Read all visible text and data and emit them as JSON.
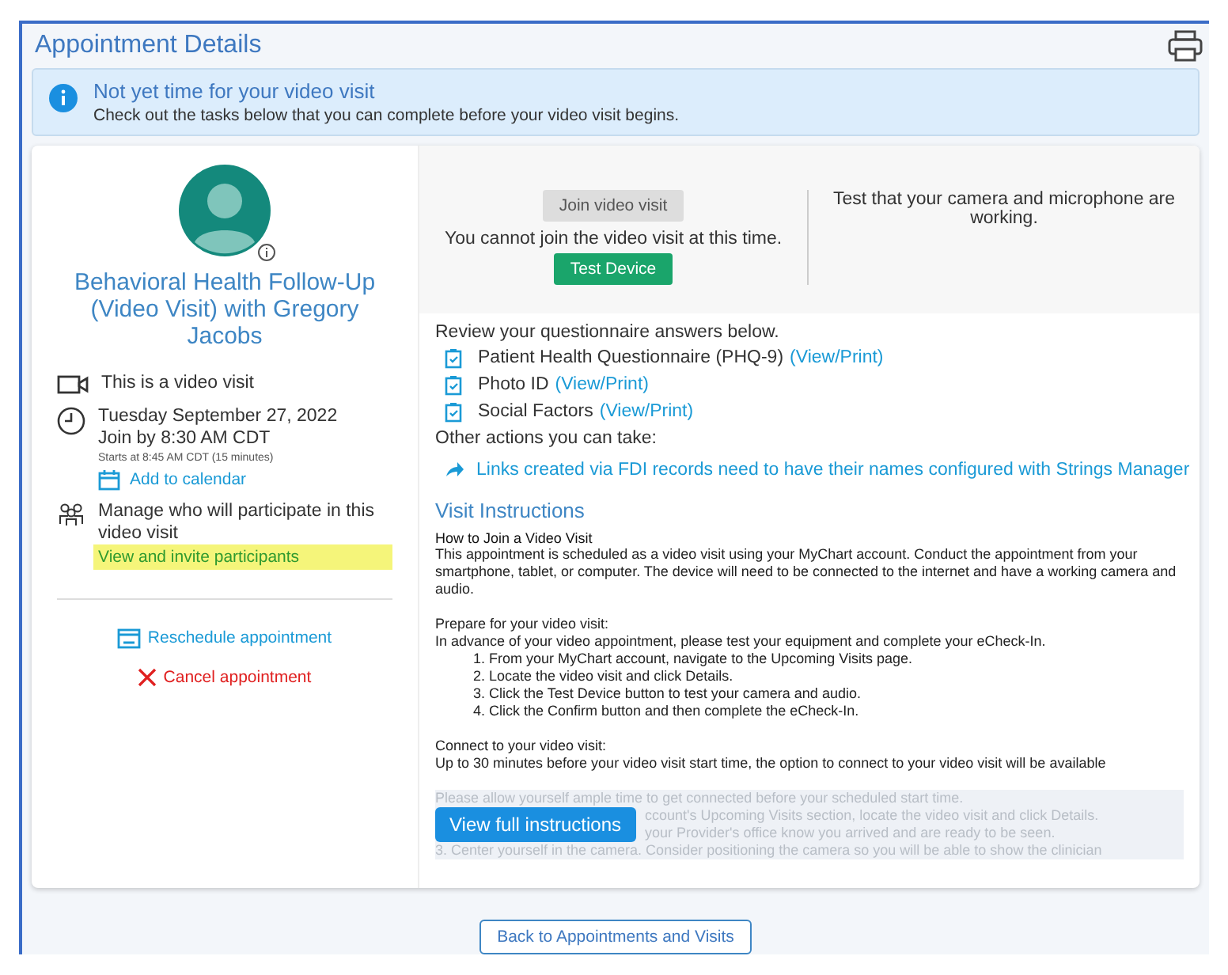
{
  "page": {
    "title": "Appointment Details"
  },
  "banner": {
    "title": "Not yet time for your video visit",
    "text": "Check out the tasks below that you can complete before your video visit begins."
  },
  "appointment": {
    "title": "Behavioral Health Follow-Up (Video Visit) with Gregory Jacobs",
    "details": [
      {
        "kind": "video",
        "lines": [
          "This is a video visit"
        ]
      },
      {
        "kind": "time",
        "lines": [
          "Tuesday September 27, 2022",
          "Join by 8:30 AM CDT"
        ],
        "note": "Starts at 8:45 AM CDT (15 minutes)",
        "link": "Add to calendar"
      },
      {
        "kind": "participants",
        "lines": [
          "Manage who will participate in this video visit"
        ],
        "link": "View and invite participants",
        "highlighted": true
      }
    ],
    "actions": [
      {
        "kind": "reschedule",
        "label": "Reschedule appointment"
      },
      {
        "kind": "cancel",
        "label": "Cancel appointment"
      }
    ]
  },
  "video": {
    "join_button": {
      "label": "Join video visit",
      "disabled": true
    },
    "message": "You cannot join the video visit at this time.",
    "test_button": "Test Device",
    "test_text": "Test that your camera and microphone are working."
  },
  "questionnaires": {
    "heading": "Review your questionnaire answers below.",
    "items": [
      {
        "name": "Patient Health Questionnaire (PHQ-9)",
        "link": "(View/Print)"
      },
      {
        "name": "Photo ID",
        "link": "(View/Print)"
      },
      {
        "name": "Social Factors",
        "link": "(View/Print)"
      }
    ]
  },
  "other_actions": {
    "heading": "Other actions you can take:",
    "items": [
      "Links created via FDI records need to have their names configured with Strings Manager"
    ]
  },
  "instructions": {
    "heading": "Visit Instructions",
    "subheading": "How to Join a Video Visit",
    "paragraphs": [
      [
        "This appointment is scheduled as a video visit using your MyChart account. Conduct the appointment from your smartphone, tablet, or computer. The device will need to be connected to the internet and have a working camera and audio."
      ],
      [
        "Prepare for your video visit:",
        "In advance of your video appointment, please test your equipment and complete your eCheck-In."
      ]
    ],
    "steps": [
      "1. From your MyChart account, navigate to the Upcoming Visits page.",
      "2. Locate the video visit and click Details.",
      "3. Click the Test Device button to test your camera and audio.",
      "4. Click the Confirm button and then complete the eCheck-In."
    ],
    "connect_heading": "Connect to your video visit:",
    "connect_text": "Up to 30 minutes before your video visit start time, the option to connect to your video visit will be available",
    "faded_lines": [
      "Please allow yourself ample time to get connected before your scheduled start time.",
      "ccount's Upcoming Visits section, locate the video visit and click Details.",
      "your Provider's office know you arrived and are ready to be seen.",
      "3. Center yourself in the camera. Consider positioning the camera so you will be able to show the clinician"
    ],
    "more_button": "View full instructions"
  },
  "back_button": "Back to Appointments and Visits"
}
